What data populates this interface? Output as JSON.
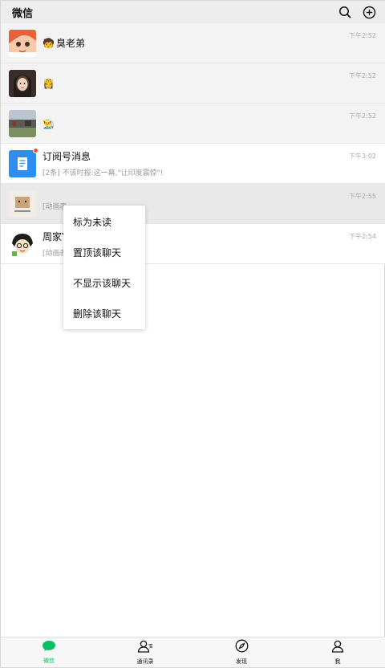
{
  "header": {
    "title": "微信"
  },
  "chats": [
    {
      "name": "臭老弟",
      "emoji": "🧒",
      "preview": "",
      "time": "下午2:52"
    },
    {
      "name": "",
      "emoji": "👸",
      "preview": "",
      "time": "下午2:52"
    },
    {
      "name": "",
      "emoji": "👨‍🌾",
      "preview": "",
      "time": "下午2:52"
    },
    {
      "name": "订阅号消息",
      "emoji": "",
      "preview": "[2条] 不该时报:这一幕,\"让印度震惊\"!",
      "time": "下午3:02"
    },
    {
      "name": "",
      "emoji": "",
      "preview": "[动画表",
      "time": "下午2:55"
    },
    {
      "name": "周家Y",
      "emoji": "",
      "preview": "[动画表",
      "time": "下午2:54"
    }
  ],
  "context_menu": {
    "items": [
      "标为未读",
      "置顶该聊天",
      "不显示该聊天",
      "删除该聊天"
    ]
  },
  "tabs": [
    {
      "label": "微信",
      "active": true
    },
    {
      "label": "通讯录",
      "active": false
    },
    {
      "label": "发现",
      "active": false
    },
    {
      "label": "我",
      "active": false
    }
  ],
  "colors": {
    "accent": "#07c160",
    "badge": "#f24c3d",
    "header_bg": "#ededed"
  }
}
